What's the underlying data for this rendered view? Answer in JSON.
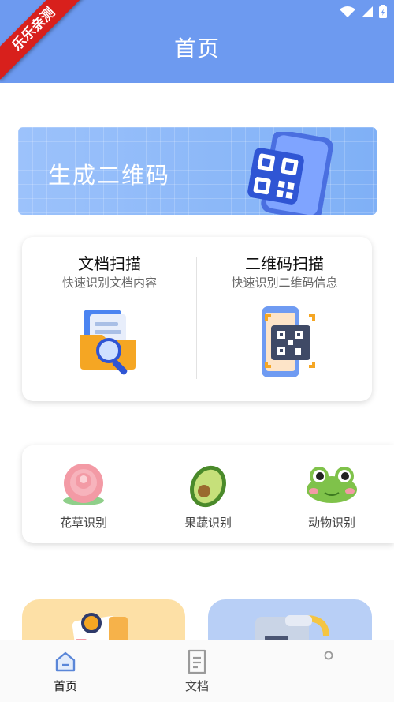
{
  "header": {
    "title": "首页",
    "ribbon": "乐乐亲测"
  },
  "banner": {
    "label": "生成二维码"
  },
  "scan": [
    {
      "title": "文档扫描",
      "subtitle": "快速识别文档内容"
    },
    {
      "title": "二维码扫描",
      "subtitle": "快速识别二维码信息"
    }
  ],
  "identify": [
    {
      "label": "花草识别",
      "icon": "flower-icon"
    },
    {
      "label": "果蔬识别",
      "icon": "avocado-icon"
    },
    {
      "label": "动物识别",
      "icon": "frog-icon"
    }
  ],
  "tabbar": [
    {
      "label": "首页",
      "icon": "home-icon",
      "active": true
    },
    {
      "label": "文档",
      "icon": "document-icon",
      "active": false
    }
  ],
  "colors": {
    "primary": "#6d9af0",
    "ribbon": "#d8201c",
    "active_tab": "#5a86d8"
  }
}
